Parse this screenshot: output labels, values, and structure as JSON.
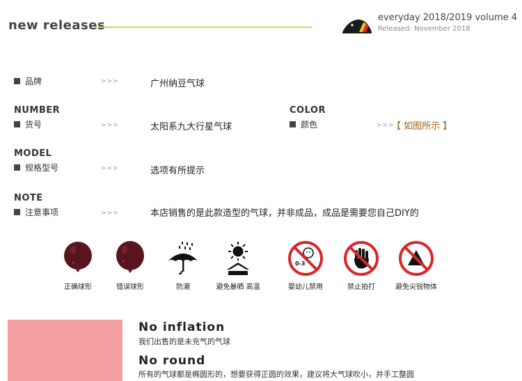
{
  "header": {
    "title": "new releases",
    "volume": "everyday 2018/2019 volume 4",
    "released": "Released: November 2018"
  },
  "specs": {
    "arrow": ">>>",
    "brand_label": "品牌",
    "brand_value": "广州纳豆气球",
    "number_heading": "NUMBER",
    "item_label": "货号",
    "item_value": "太阳系九大行星气球",
    "color_heading": "COLOR",
    "color_label": "颜色",
    "color_value": "【 如图所示 】",
    "model_heading": "MODEL",
    "model_label": "规格型号",
    "model_value": "选项有所提示",
    "note_heading": "NOTE",
    "note_label": "注意事项",
    "note_value": "本店销售的是此款造型的气球，并非成品，成品是需要您自己DIY的"
  },
  "icons": [
    {
      "icon": "balloon-correct-icon",
      "label": "正确球形"
    },
    {
      "icon": "balloon-wrong-icon",
      "label": "错误球形"
    },
    {
      "icon": "umbrella-icon",
      "label": "防潮"
    },
    {
      "icon": "sun-icon",
      "label": "避免暴晒  高温"
    },
    {
      "icon": "no-infant-icon",
      "label": "婴幼儿禁用"
    },
    {
      "icon": "no-hit-icon",
      "label": "禁止拍打"
    },
    {
      "icon": "no-sharp-icon",
      "label": "避免尖锐物体"
    }
  ],
  "age_badge": "0-3",
  "notes": {
    "inflation_title": "No inflation",
    "inflation_text": "我们出售的是未充气的气球",
    "round_title": "No round",
    "round_text": "所有的气球都是椭圆形的，想要获得正圆的效果，建议将大气球吹小，并手工整圆"
  },
  "colors": {
    "accent_line": "#c3d95a",
    "balloon": "#5a1420",
    "warning_red": "#d8262b",
    "swatch": "#f4a0a2"
  }
}
